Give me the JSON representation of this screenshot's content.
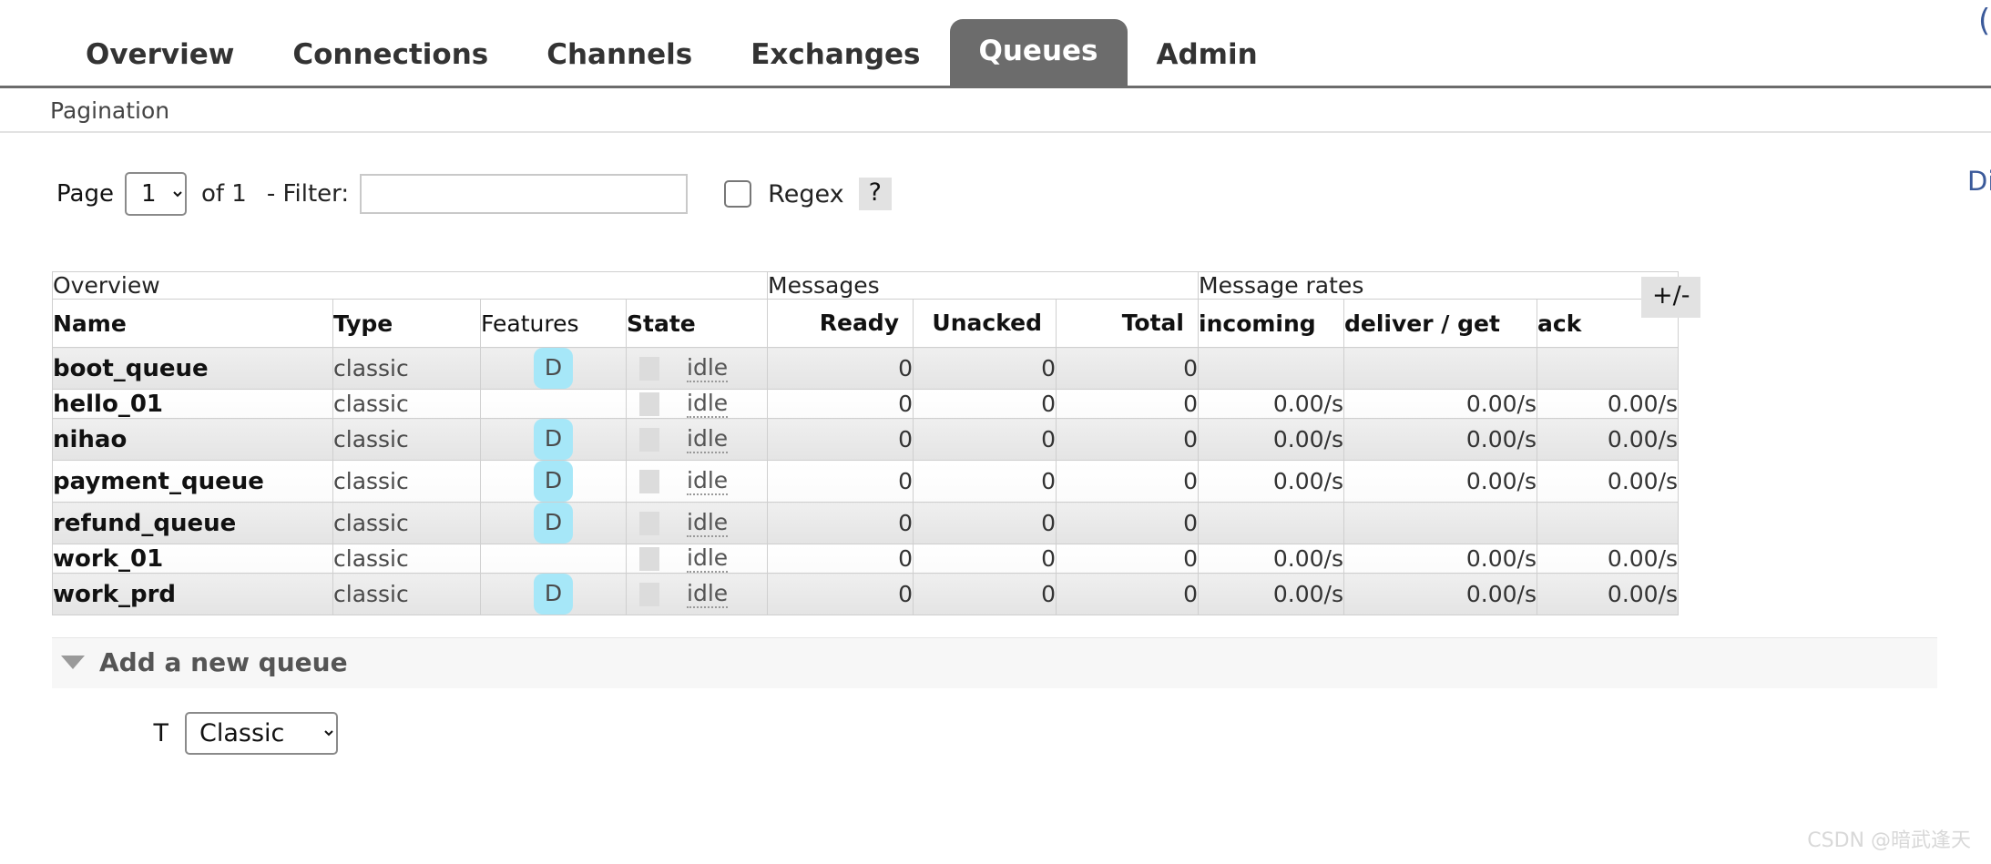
{
  "nav": {
    "tabs": [
      {
        "label": "Overview",
        "active": false
      },
      {
        "label": "Connections",
        "active": false
      },
      {
        "label": "Channels",
        "active": false
      },
      {
        "label": "Exchanges",
        "active": false
      },
      {
        "label": "Queues",
        "active": true
      },
      {
        "label": "Admin",
        "active": false
      }
    ],
    "corner_glyph": "("
  },
  "pagination": {
    "heading": "Pagination",
    "page_label": "Page",
    "page_value": "1",
    "page_options": [
      "1"
    ],
    "of_text": "of 1",
    "filter_label": "- Filter:",
    "filter_value": "",
    "filter_placeholder": "",
    "regex_label": "Regex",
    "regex_checked": false,
    "help_label": "?",
    "right_cut_text": "Di"
  },
  "table": {
    "group_headers": [
      {
        "label": "Overview",
        "span": 4
      },
      {
        "label": "Messages",
        "span": 3
      },
      {
        "label": "Message rates",
        "span": 3
      }
    ],
    "columns": [
      {
        "label": "Name",
        "bold": true,
        "align": "left"
      },
      {
        "label": "Type",
        "bold": true,
        "align": "left"
      },
      {
        "label": "Features",
        "bold": false,
        "align": "left"
      },
      {
        "label": "State",
        "bold": true,
        "align": "left"
      },
      {
        "label": "Ready",
        "bold": true,
        "align": "right"
      },
      {
        "label": "Unacked",
        "bold": true,
        "align": "right"
      },
      {
        "label": "Total",
        "bold": true,
        "align": "right"
      },
      {
        "label": "incoming",
        "bold": true,
        "align": "left"
      },
      {
        "label": "deliver / get",
        "bold": true,
        "align": "left"
      },
      {
        "label": "ack",
        "bold": true,
        "align": "left"
      }
    ],
    "plus_minus_label": "+/-",
    "rows": [
      {
        "name": "boot_queue",
        "type": "classic",
        "feature": "D",
        "state": "idle",
        "ready": "0",
        "unacked": "0",
        "total": "0",
        "incoming": "",
        "deliver_get": "",
        "ack": ""
      },
      {
        "name": "hello_01",
        "type": "classic",
        "feature": "",
        "state": "idle",
        "ready": "0",
        "unacked": "0",
        "total": "0",
        "incoming": "0.00/s",
        "deliver_get": "0.00/s",
        "ack": "0.00/s"
      },
      {
        "name": "nihao",
        "type": "classic",
        "feature": "D",
        "state": "idle",
        "ready": "0",
        "unacked": "0",
        "total": "0",
        "incoming": "0.00/s",
        "deliver_get": "0.00/s",
        "ack": "0.00/s"
      },
      {
        "name": "payment_queue",
        "type": "classic",
        "feature": "D",
        "state": "idle",
        "ready": "0",
        "unacked": "0",
        "total": "0",
        "incoming": "0.00/s",
        "deliver_get": "0.00/s",
        "ack": "0.00/s"
      },
      {
        "name": "refund_queue",
        "type": "classic",
        "feature": "D",
        "state": "idle",
        "ready": "0",
        "unacked": "0",
        "total": "0",
        "incoming": "",
        "deliver_get": "",
        "ack": ""
      },
      {
        "name": "work_01",
        "type": "classic",
        "feature": "",
        "state": "idle",
        "ready": "0",
        "unacked": "0",
        "total": "0",
        "incoming": "0.00/s",
        "deliver_get": "0.00/s",
        "ack": "0.00/s"
      },
      {
        "name": "work_prd",
        "type": "classic",
        "feature": "D",
        "state": "idle",
        "ready": "0",
        "unacked": "0",
        "total": "0",
        "incoming": "0.00/s",
        "deliver_get": "0.00/s",
        "ack": "0.00/s"
      }
    ]
  },
  "add_queue": {
    "heading": "Add a new queue",
    "type_label": "T",
    "type_value": "Classic",
    "type_options": [
      "Classic"
    ]
  },
  "watermark": "CSDN @暗武逢天",
  "colors": {
    "active_tab_bg": "#6c6c6c",
    "feature_badge_bg": "#a6e7f8",
    "row_odd_bg": "#e9e9e9",
    "row_even_bg": "#ffffff",
    "border": "#cfcfcf"
  }
}
